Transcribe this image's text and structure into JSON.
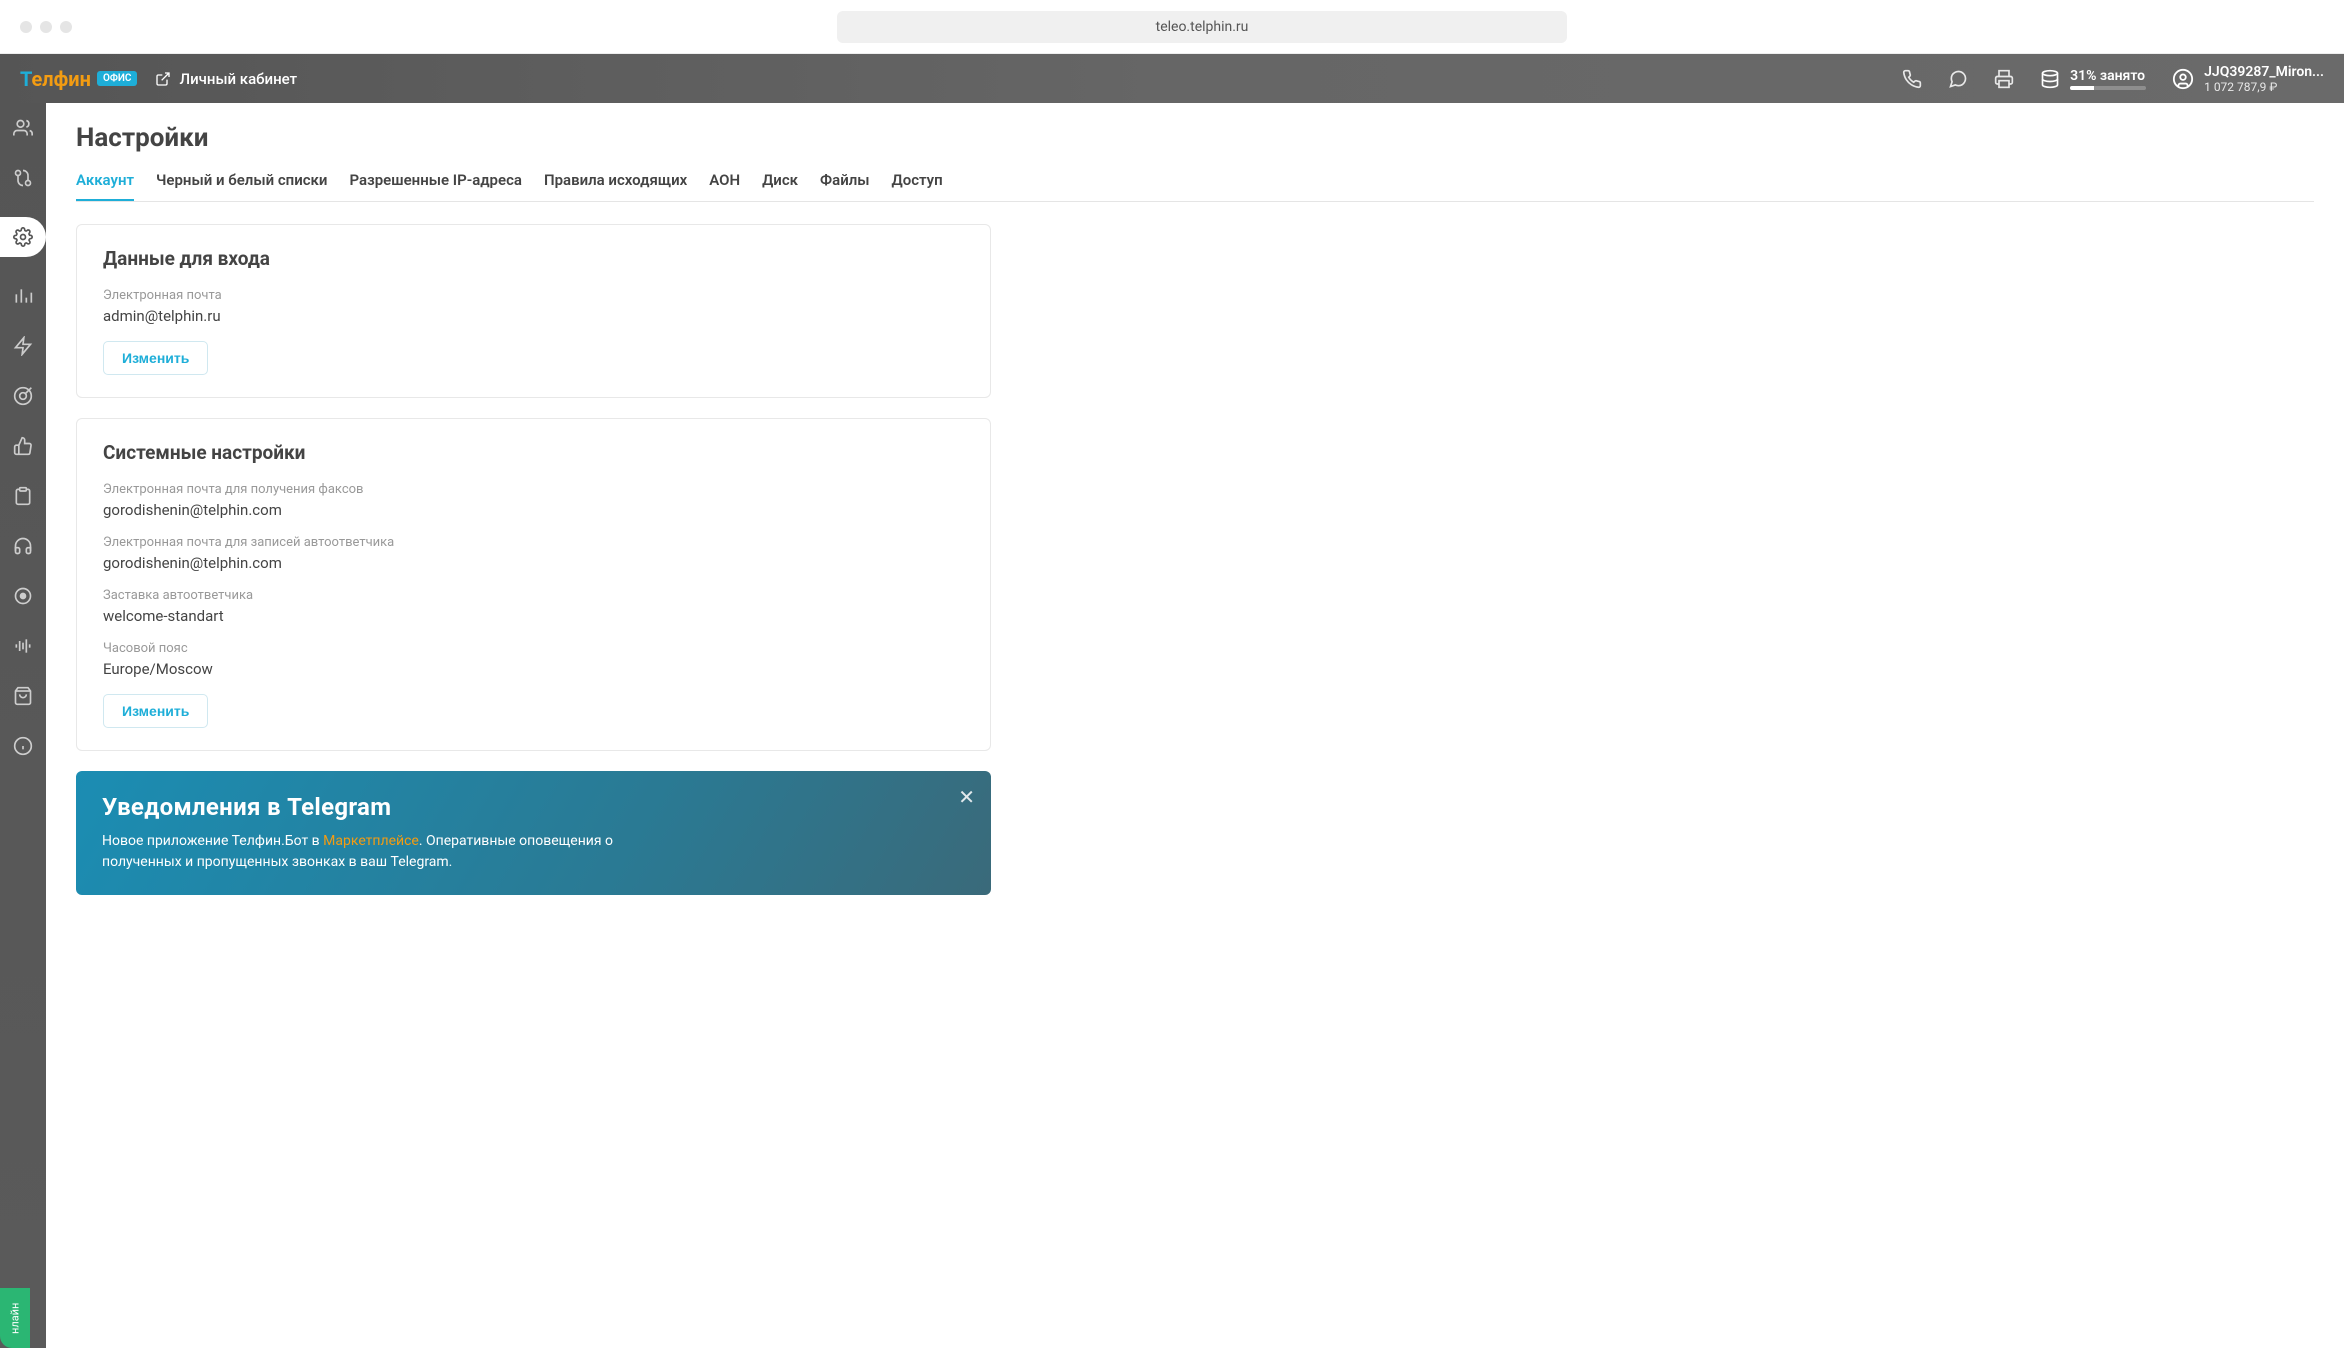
{
  "browser": {
    "url": "teleo.telphin.ru"
  },
  "header": {
    "logo_main": "Телфин",
    "logo_badge": "ОФИС",
    "cabinet_link": "Личный кабинет",
    "storage_percent": 31,
    "storage_label": "31% занято",
    "user_name": "JJQ39287_Miron...",
    "user_balance": "1 072 787,9 ₽"
  },
  "page": {
    "title": "Настройки",
    "tabs": [
      {
        "label": "Аккаунт",
        "active": true
      },
      {
        "label": "Черный и белый списки"
      },
      {
        "label": "Разрешенные IP-адреса"
      },
      {
        "label": "Правила исходящих"
      },
      {
        "label": "АОН"
      },
      {
        "label": "Диск"
      },
      {
        "label": "Файлы"
      },
      {
        "label": "Доступ"
      }
    ]
  },
  "login_card": {
    "title": "Данные для входа",
    "email_label": "Электронная почта",
    "email_value": "admin@telphin.ru",
    "edit_button": "Изменить"
  },
  "system_card": {
    "title": "Системные настройки",
    "fax_email_label": "Электронная почта для получения факсов",
    "fax_email_value": "gorodishenin@telphin.com",
    "vm_email_label": "Электронная почта для записей автоответчика",
    "vm_email_value": "gorodishenin@telphin.com",
    "greeting_label": "Заставка автоответчика",
    "greeting_value": "welcome-standart",
    "tz_label": "Часовой пояс",
    "tz_value": "Europe/Moscow",
    "edit_button": "Изменить"
  },
  "promo": {
    "title": "Уведомления в Telegram",
    "text_before": "Новое приложение Телфин.Бот в ",
    "link": "Маркетплейсе",
    "text_after": ". Оперативные оповещения о полученных и пропущенных звонках в ваш Telegram."
  },
  "online_tab": "нлайн"
}
